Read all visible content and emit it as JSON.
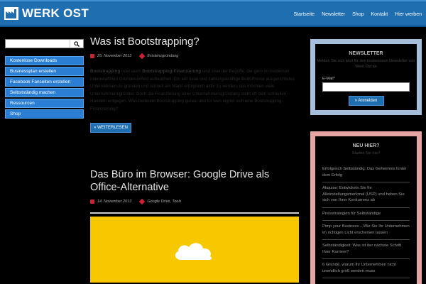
{
  "header": {
    "logo_text": "WERK OST",
    "nav": [
      "Startseite",
      "Newsletter",
      "Shop",
      "Kontakt",
      "Hier werben"
    ]
  },
  "sidebar": {
    "search": {
      "value": "",
      "placeholder": ""
    },
    "menu": [
      "Kostenlose Downloads",
      "Businessplan erstellen",
      "Facebook Fanseiten erstellen",
      "Selbstständig machen",
      "Ressourcen",
      "Shop"
    ]
  },
  "posts": [
    {
      "title": "Was ist Bootstrapping?",
      "date": "25. November 2013",
      "category": "Existenzgründung",
      "body_b1": "Bootstrapping",
      "body_t1": " oder auch ",
      "body_b2": "Bootstrapping-Finanzierung",
      "body_t2": " sind zwei der Begriffe, die gern im modernen internetaffinen Gründerumfeld auftauchen. Ein auf neue und zahlungskräftige Bedürfnisse ausgerichtetes Unternehmen zu gründen und schnell am Markt erfolgreich aktiv zu werden, das möchten viele Unternehmensgründer. Doch die Finanzierung einer Unternehmensgründung steht oft dem schnellen Handeln entgegen. Was bedeutet Bootstrapping genau und für wen eignet sich eine Bootstrapping-Finanzierung?",
      "more": "» WEITERLESEN"
    },
    {
      "title": "Das Büro im Browser: Google Drive als Office-Alternative",
      "date": "14. November 2013",
      "category": "Google Drive, Tools"
    }
  ],
  "newsletter": {
    "title": "NEWSLETTER",
    "subtitle": "Melden Sie sich jetzt für den kostenlosen Newsletter von Werk Ost an",
    "email_label": "E-Mail*",
    "email_value": "",
    "button": "» Anmelden"
  },
  "hier": {
    "title": "NEU HIER?",
    "subtitle": "Starten Sie hier!",
    "items": [
      "Erfolgreich Selbständig: Das Geheimnis hinter dem Erfolg",
      "Akquise: Entwickeln Sie Ihr Alleinstellungsmerkmal (USP) und heben Sie sich von Ihrer Konkurrenz ab",
      "Preisstrategien für Selbständige",
      "Pimp your Business – Wie Sie Ihr Unternehmen im richtigen Licht erscheinen lassen",
      "Selbständigkeit: Was ist der nächste Schritt Ihrer Karriere?",
      "6 Gründe, warum Ihr Unternehmen nicht unendlich groß werden muss"
    ]
  },
  "colors": {
    "brand": "#1f6fb0",
    "accent_red": "#cc2233",
    "feature_yellow": "#f7c800"
  }
}
